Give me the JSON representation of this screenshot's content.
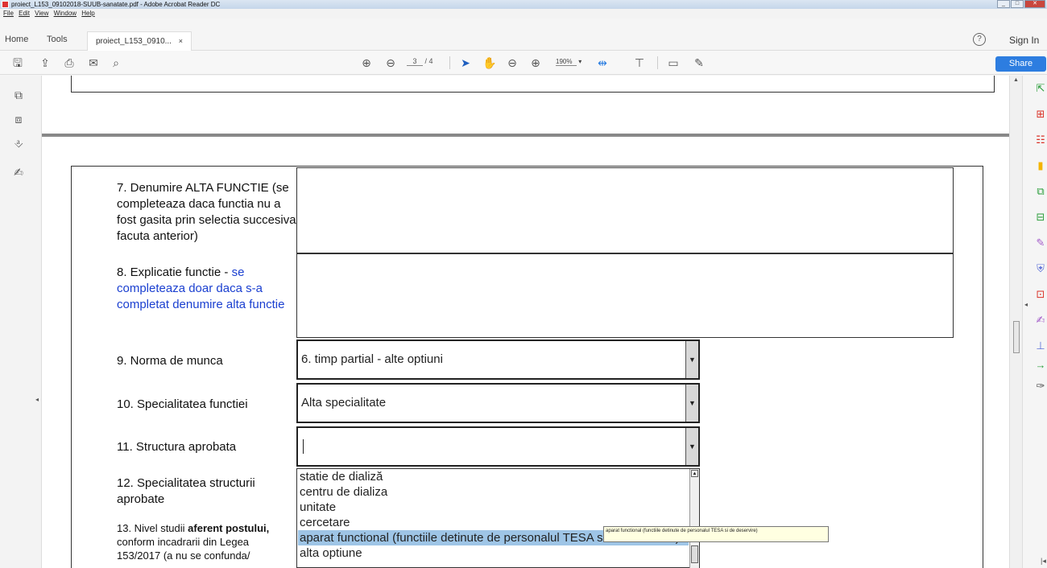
{
  "window": {
    "title": "proiect_L153_09102018-SUUB-sanatate.pdf - Adobe Acrobat Reader DC"
  },
  "menu": [
    "File",
    "Edit",
    "View",
    "Window",
    "Help"
  ],
  "tabs": {
    "home": "Home",
    "tools": "Tools",
    "doc": "proiect_L153_0910...",
    "close": "×"
  },
  "help_icon": "?",
  "signin": "Sign In",
  "toolbar": {
    "page_current": "3",
    "page_total": "/ 4",
    "zoom": "190%",
    "share": "Share"
  },
  "form": {
    "q7": "7. Denumire ALTA FUNCTIE (se completeaza daca functia nu a fost gasita prin selectia succesiva facuta anterior)",
    "q8_a": "8. Explicatie functie - ",
    "q8_b": "se completeaza doar daca s-a completat denumire alta functie",
    "q9": "9. Norma de munca",
    "q9_val": "6. timp partial - alte optiuni",
    "q10": "10. Specialitatea functiei",
    "q10_val": "Alta specialitate",
    "q11": "11. Structura aprobata",
    "q12": "12. Specialitatea structurii aprobate",
    "q13_a": "13. Nivel studii ",
    "q13_b": "aferent postului,",
    "q13_c": " conform incadrarii din Legea 153/2017 (a nu se confunda/",
    "dropdown_options": [
      "statie de dializă",
      "centru de dializa",
      "unitate",
      "cercetare",
      "aparat functional (functiile detinute de personalul TESA si de deservire)",
      "alta optiune"
    ],
    "selected_index": 4,
    "tooltip": "aparat functional (functiile detinute de personalul TESA si de deservire)"
  },
  "icons": {
    "left": [
      "bookmarks-icon",
      "pages-icon",
      "attachment-icon",
      "signature-icon"
    ],
    "right": [
      "export-pdf-icon",
      "create-pdf-icon",
      "organize-pages-icon",
      "comment-icon",
      "combine-files-icon",
      "edit-pdf-icon",
      "fill-sign-icon",
      "protect-icon",
      "compress-icon",
      "send-for-signature-icon",
      "measure-icon",
      "more-tools-icon",
      "scan-icon"
    ]
  }
}
